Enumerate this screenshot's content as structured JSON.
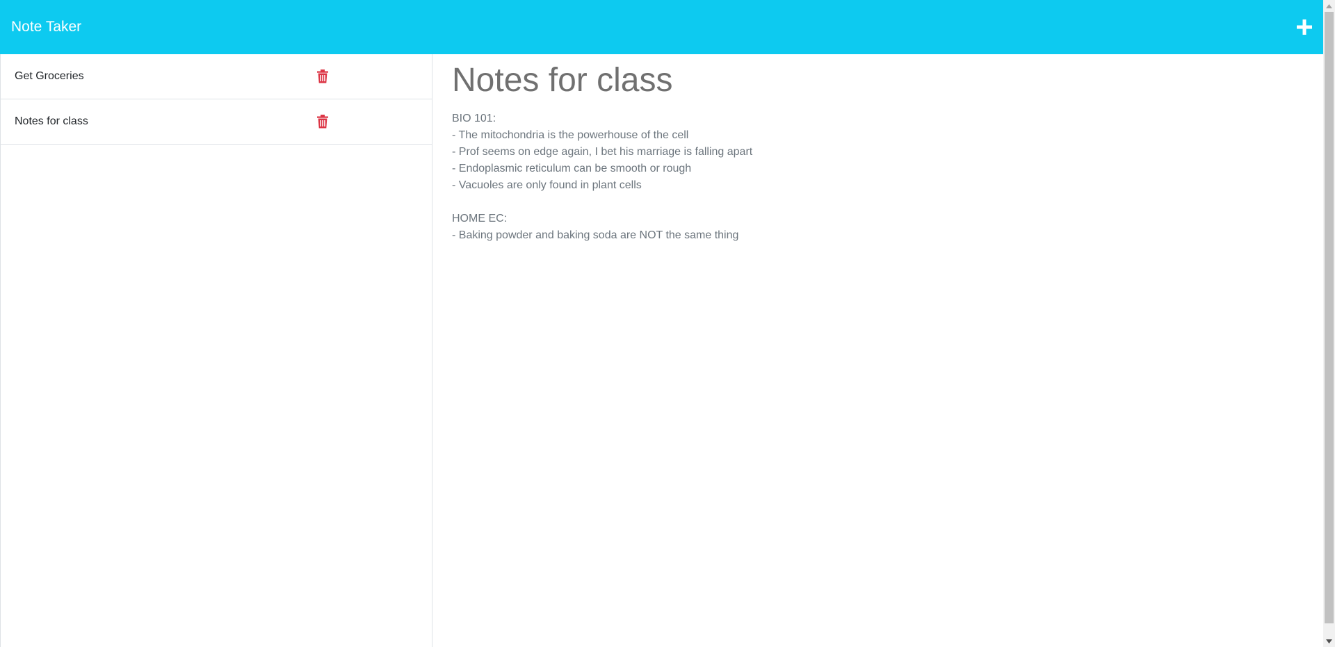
{
  "navbar": {
    "brand": "Note Taker",
    "add_icon": "plus-icon"
  },
  "notes": [
    {
      "title": "Get Groceries",
      "delete_icon": "trash-icon"
    },
    {
      "title": "Notes for class",
      "delete_icon": "trash-icon"
    }
  ],
  "active_note": {
    "title": "Notes for class",
    "lines": [
      "BIO 101:",
      "- The mitochondria is the powerhouse of the cell",
      "- Prof seems on edge again, I bet his marriage is falling apart",
      "- Endoplasmic reticulum can be smooth or rough",
      "- Vacuoles are only found in plant cells",
      "",
      "HOME EC:",
      "- Baking powder and baking soda are NOT the same thing"
    ]
  },
  "colors": {
    "navbar": "#0dcaf0",
    "delete": "#dc3545",
    "text_muted": "#6c757d"
  }
}
